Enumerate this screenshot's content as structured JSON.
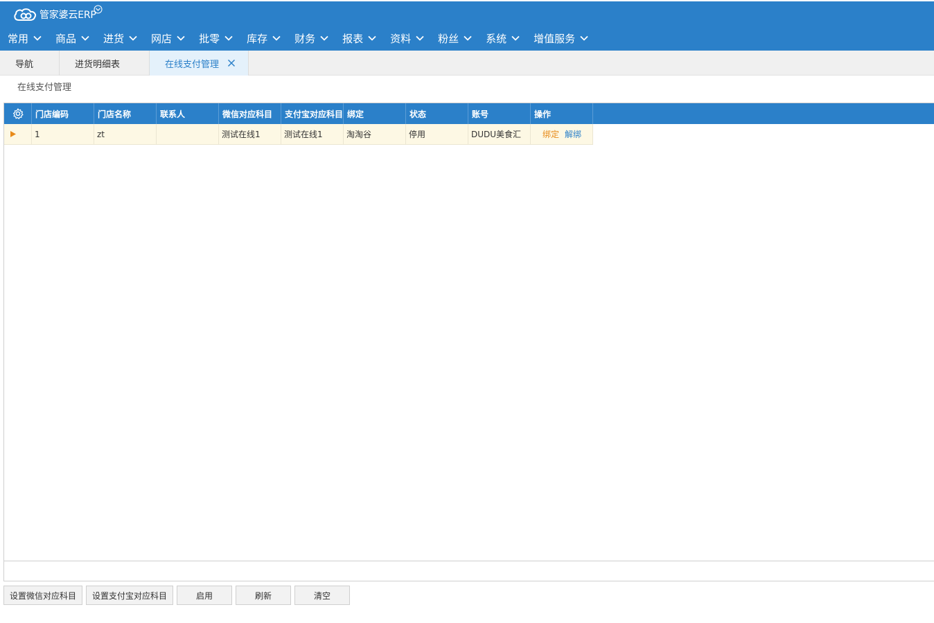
{
  "app": {
    "logo_text": "管家婆云ERP",
    "logo_icon": "cloud-logo-icon",
    "accent_color": "#2b80c9"
  },
  "menu": [
    {
      "label": "常用"
    },
    {
      "label": "商品"
    },
    {
      "label": "进货"
    },
    {
      "label": "网店"
    },
    {
      "label": "批零"
    },
    {
      "label": "库存"
    },
    {
      "label": "财务"
    },
    {
      "label": "报表"
    },
    {
      "label": "资料"
    },
    {
      "label": "粉丝"
    },
    {
      "label": "系统"
    },
    {
      "label": "增值服务"
    }
  ],
  "tabs": [
    {
      "label": "导航",
      "active": false
    },
    {
      "label": "进货明细表",
      "active": false
    },
    {
      "label": "在线支付管理",
      "active": true
    }
  ],
  "page": {
    "title": "在线支付管理"
  },
  "grid": {
    "columns": [
      "门店编码",
      "门店名称",
      "联系人",
      "微信对应科目",
      "支付宝对应科目",
      "绑定",
      "状态",
      "账号",
      "操作"
    ],
    "rows": [
      {
        "store_code": "1",
        "store_name": "zt",
        "contact": "",
        "wechat_subject": "测试在线1",
        "alipay_subject": "测试在线1",
        "binding": "淘淘谷",
        "status": "停用",
        "account": "DUDU美食汇",
        "action_bind": "绑定",
        "action_unbind": "解绑"
      }
    ]
  },
  "buttons": {
    "set_wechat": "设置微信对应科目",
    "set_alipay": "设置支付宝对应科目",
    "enable": "启用",
    "refresh": "刷新",
    "clear": "清空"
  }
}
